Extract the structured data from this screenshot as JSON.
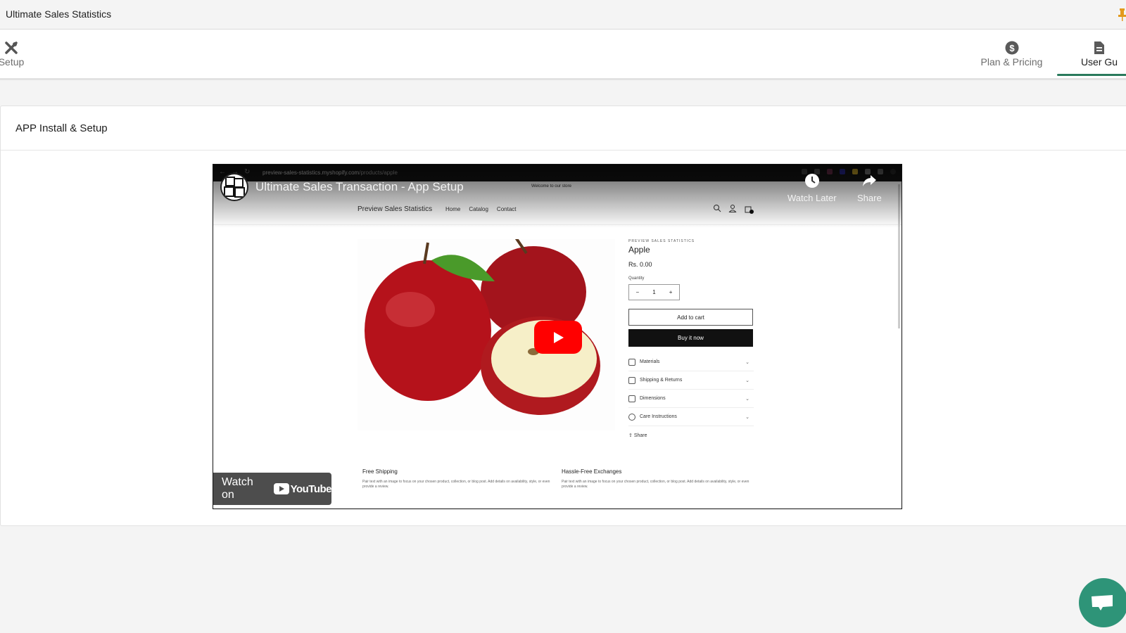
{
  "app": {
    "title": "Ultimate Sales Statistics",
    "pin_color": "#e39a1d"
  },
  "nav": {
    "tabs": [
      {
        "label": "Setup",
        "icon": "tools-icon",
        "active": false
      },
      {
        "label": "Plan & Pricing",
        "icon": "dollar-circle-icon",
        "active": false
      },
      {
        "label": "User Gu",
        "icon": "document-icon",
        "active": true
      }
    ],
    "active_color": "#2a7a5c"
  },
  "section": {
    "title": "APP Install & Setup"
  },
  "video": {
    "title": "Ultimate Sales Transaction - App Setup",
    "watch_later_label": "Watch Later",
    "share_label": "Share",
    "watch_on_label": "Watch on",
    "youtube_label": "YouTube",
    "play_color": "#ff0000",
    "browser": {
      "url_host": "preview-sales-statistics.myshopify.com",
      "url_path": "/products/apple"
    },
    "store": {
      "welcome": "Welcome to our store",
      "brand": "Preview Sales Statistics",
      "nav": [
        "Home",
        "Catalog",
        "Contact"
      ],
      "cart_count": "1",
      "product": {
        "vendor": "PREVIEW SALES STATISTICS",
        "name": "Apple",
        "price": "Rs. 0.00",
        "quantity_label": "Quantity",
        "quantity": "1",
        "add_to_cart": "Add to cart",
        "buy_now": "Buy it now",
        "accordion": [
          "Materials",
          "Shipping & Returns",
          "Dimensions",
          "Care Instructions"
        ],
        "share": "Share"
      },
      "features": [
        {
          "title": "Free Shipping",
          "text": "Pair text with an image to focus on your chosen product, collection, or blog post. Add details on availability, style, or even provide a review."
        },
        {
          "title": "Hassle-Free Exchanges",
          "text": "Pair text with an image to focus on your chosen product, collection, or blog post. Add details on availability, style, or even provide a review."
        }
      ]
    }
  },
  "chat": {
    "color": "#2e9478"
  }
}
